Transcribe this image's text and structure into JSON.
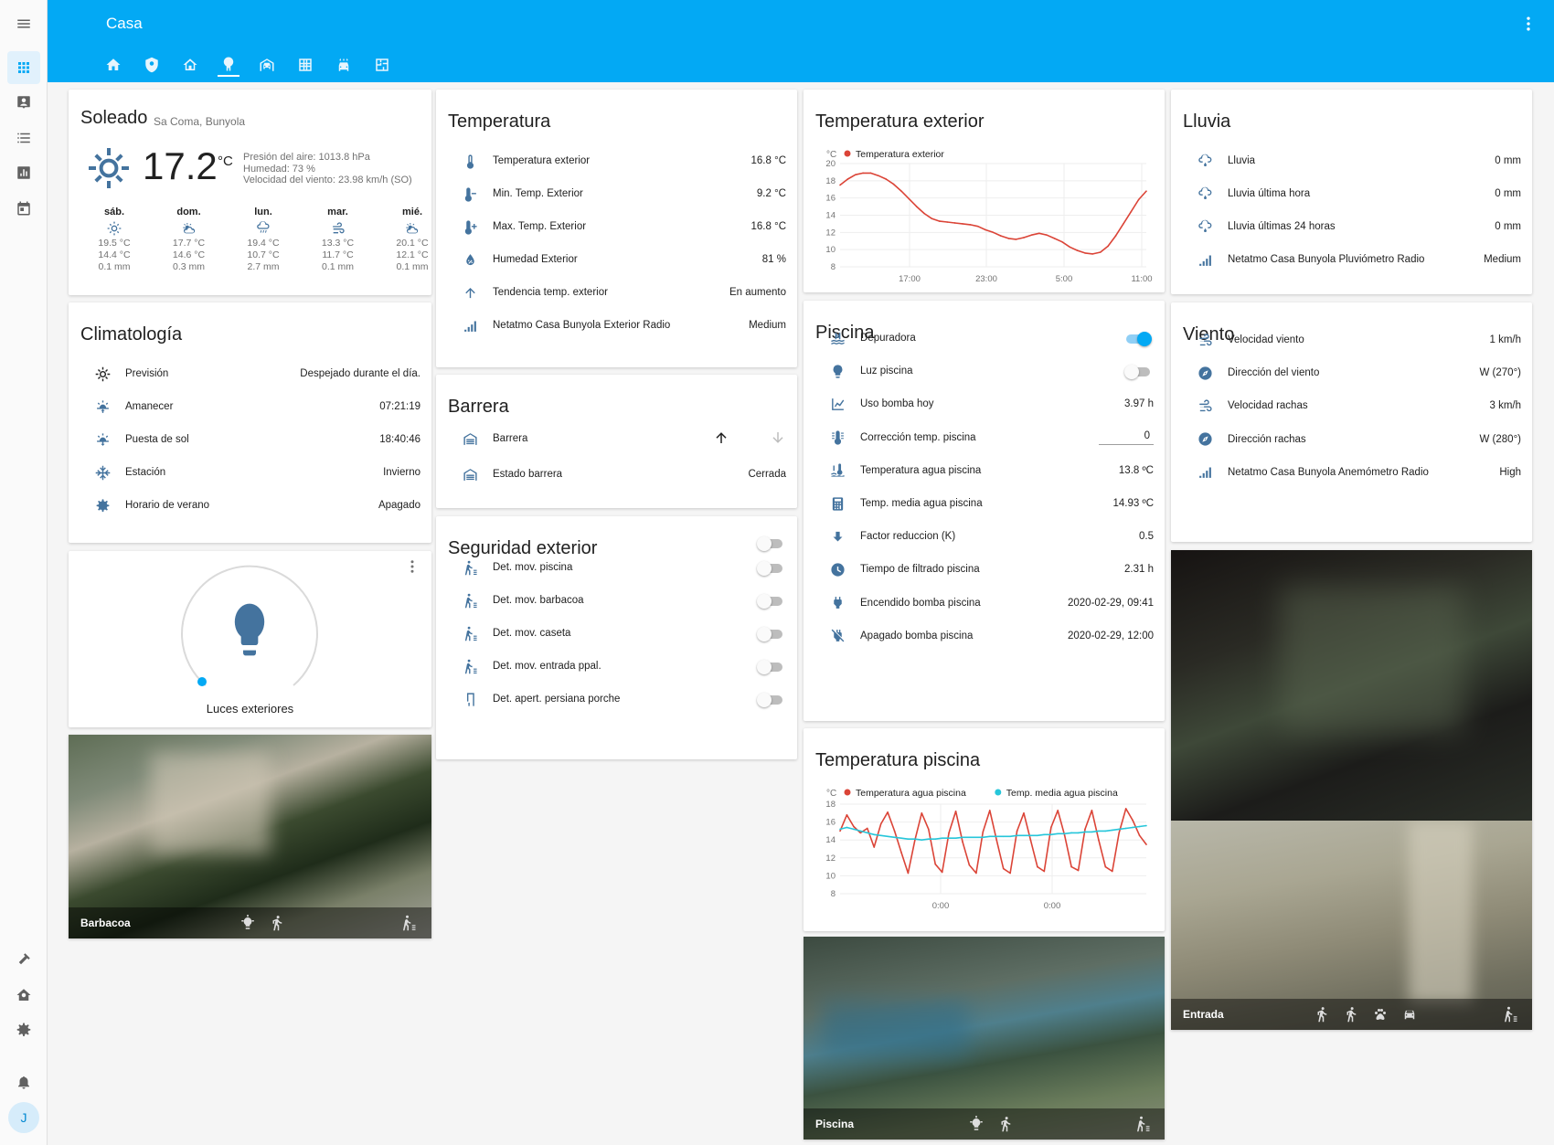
{
  "app": {
    "title": "Casa",
    "avatar": "J"
  },
  "colors": {
    "primary": "#03a9f4",
    "icon": "#44739e",
    "red_series": "#db4437",
    "teal_series": "#26c6da"
  },
  "sidebar_icons": [
    "menu-icon",
    "overview-icon",
    "map-icon",
    "logbook-icon",
    "history-icon",
    "calendar-icon",
    "developer-tools-icon",
    "configuration-home-icon",
    "settings-icon",
    "notifications-icon"
  ],
  "tabs": [
    "home-icon",
    "shield-icon",
    "home-outline-icon",
    "tree-icon",
    "garage-icon",
    "grid-icon",
    "car-wash-icon",
    "floor-plan-icon"
  ],
  "weather": {
    "condition": "Soleado",
    "location": "Sa Coma, Bunyola",
    "temp": "17.2",
    "unit": "°C",
    "pressure": "Presión del aire: 1013.8 hPa",
    "humidity": "Humedad: 73 %",
    "wind": "Velocidad del viento: 23.98 km/h (SO)",
    "forecast": [
      {
        "day": "sáb.",
        "icon": "sunny-icon",
        "high": "19.5 °C",
        "low": "14.4 °C",
        "rain": "0.1 mm"
      },
      {
        "day": "dom.",
        "icon": "partly-cloudy-icon",
        "high": "17.7 °C",
        "low": "14.6 °C",
        "rain": "0.3 mm"
      },
      {
        "day": "lun.",
        "icon": "rainy-icon",
        "high": "19.4 °C",
        "low": "10.7 °C",
        "rain": "2.7 mm"
      },
      {
        "day": "mar.",
        "icon": "windy-icon",
        "high": "13.3 °C",
        "low": "11.7 °C",
        "rain": "0.1 mm"
      },
      {
        "day": "mié.",
        "icon": "partly-cloudy-icon",
        "high": "20.1 °C",
        "low": "12.1 °C",
        "rain": "0.1 mm"
      }
    ]
  },
  "climatologia": {
    "title": "Climatología",
    "rows": [
      {
        "icon": "sun-icon",
        "label": "Previsión",
        "value": "Despejado durante el día."
      },
      {
        "icon": "sunrise-icon",
        "label": "Amanecer",
        "value": "07:21:19"
      },
      {
        "icon": "sunset-icon",
        "label": "Puesta de sol",
        "value": "18:40:46"
      },
      {
        "icon": "snowflake-icon",
        "label": "Estación",
        "value": "Invierno"
      },
      {
        "icon": "gear-icon",
        "label": "Horario de verano",
        "value": "Apagado"
      }
    ]
  },
  "light": {
    "name": "Luces exteriores",
    "level": 0.0
  },
  "cameras": {
    "barbacoa": {
      "name": "Barbacoa"
    },
    "piscina": {
      "name": "Piscina"
    },
    "entrada": {
      "name": "Entrada"
    }
  },
  "temperatura": {
    "title": "Temperatura",
    "rows": [
      {
        "icon": "thermometer-icon",
        "label": "Temperatura exterior",
        "value": "16.8 °C"
      },
      {
        "icon": "thermometer-minus-icon",
        "label": "Min. Temp. Exterior",
        "value": "9.2 °C"
      },
      {
        "icon": "thermometer-plus-icon",
        "label": "Max. Temp. Exterior",
        "value": "16.8 °C"
      },
      {
        "icon": "water-percent-icon",
        "label": "Humedad Exterior",
        "value": "81 %"
      },
      {
        "icon": "arrow-up-icon",
        "label": "Tendencia temp. exterior",
        "value": "En aumento"
      },
      {
        "icon": "signal-icon",
        "label": "Netatmo Casa Bunyola Exterior Radio",
        "value": "Medium"
      }
    ]
  },
  "barrera": {
    "title": "Barrera",
    "rows": [
      {
        "icon": "garage-icon",
        "label": "Barrera"
      },
      {
        "icon": "garage-icon",
        "label": "Estado barrera",
        "value": "Cerrada"
      }
    ]
  },
  "seguridad": {
    "title": "Seguridad exterior",
    "rows": [
      {
        "icon": "motion-sensor-icon",
        "label": "Det. mov. piscina"
      },
      {
        "icon": "motion-sensor-icon",
        "label": "Det. mov. barbacoa"
      },
      {
        "icon": "motion-sensor-icon",
        "label": "Det. mov. caseta"
      },
      {
        "icon": "motion-sensor-icon",
        "label": "Det. mov. entrada ppal."
      },
      {
        "icon": "door-icon",
        "label": "Det. apert. persiana porche"
      }
    ]
  },
  "temp_ext_chart": {
    "title": "Temperatura exterior"
  },
  "piscina": {
    "title": "Piscina",
    "rows": [
      {
        "icon": "pool-icon",
        "label": "Depuradora",
        "toggle": true
      },
      {
        "icon": "lightbulb-icon",
        "label": "Luz piscina",
        "toggle": false
      },
      {
        "icon": "chart-line-icon",
        "label": "Uso bomba hoy",
        "value": "3.97 h"
      },
      {
        "icon": "thermometer-lines-icon",
        "label": "Corrección temp. piscina",
        "value": "0"
      },
      {
        "icon": "pool-thermometer-icon",
        "label": "Temperatura agua piscina",
        "value": "13.8 ºC"
      },
      {
        "icon": "calculator-icon",
        "label": "Temp. media agua piscina",
        "value": "14.93 ºC"
      },
      {
        "icon": "arrow-down-bold-icon",
        "label": "Factor reduccion (K)",
        "value": "0.5"
      },
      {
        "icon": "clock-icon",
        "label": "Tiempo de filtrado piscina",
        "value": "2.31 h"
      },
      {
        "icon": "power-plug-icon",
        "label": "Encendido bomba piscina",
        "value": "2020-02-29, 09:41"
      },
      {
        "icon": "power-plug-off-icon",
        "label": "Apagado bomba piscina",
        "value": "2020-02-29, 12:00"
      }
    ]
  },
  "temp_piscina_chart": {
    "title": "Temperatura piscina"
  },
  "lluvia": {
    "title": "Lluvia",
    "rows": [
      {
        "icon": "rain-icon",
        "label": "Lluvia",
        "value": "0 mm"
      },
      {
        "icon": "rain-icon",
        "label": "Lluvia última hora",
        "value": "0 mm"
      },
      {
        "icon": "rain-icon",
        "label": "Lluvia últimas 24 horas",
        "value": "0 mm"
      },
      {
        "icon": "signal-icon",
        "label": "Netatmo Casa Bunyola Pluviómetro Radio",
        "value": "Medium"
      }
    ]
  },
  "viento": {
    "title": "Viento",
    "rows": [
      {
        "icon": "weather-windy-icon",
        "label": "Velocidad viento",
        "value": "1 km/h"
      },
      {
        "icon": "compass-icon",
        "label": "Dirección del viento",
        "value": "W (270°)"
      },
      {
        "icon": "weather-windy-icon",
        "label": "Velocidad rachas",
        "value": "3 km/h"
      },
      {
        "icon": "compass-icon",
        "label": "Dirección rachas",
        "value": "W (280°)"
      },
      {
        "icon": "signal-icon",
        "label": "Netatmo Casa Bunyola Anemómetro Radio",
        "value": "High"
      }
    ]
  },
  "chart_data": [
    {
      "type": "line",
      "title": "Temperatura exterior",
      "ylabel": "°C",
      "ylim": [
        8,
        20
      ],
      "yticks": [
        "20",
        "18",
        "16",
        "14",
        "12",
        "10",
        "8"
      ],
      "xticks": [
        "17:00",
        "23:00",
        "5:00",
        "11:00"
      ],
      "series": [
        {
          "name": "Temperatura exterior",
          "color": "#db4437",
          "x": [
            0,
            1,
            2,
            3,
            4,
            5,
            6,
            7,
            8,
            9,
            10,
            11,
            12,
            13,
            14,
            15,
            16,
            17,
            18,
            19,
            20,
            21,
            22,
            23,
            24,
            25,
            26,
            27,
            28,
            29,
            30,
            31,
            32,
            33,
            34,
            35,
            36,
            37,
            38,
            39,
            40
          ],
          "values": [
            17.5,
            18.2,
            18.7,
            18.9,
            18.9,
            18.6,
            18.2,
            17.6,
            16.8,
            15.9,
            15.0,
            14.2,
            13.6,
            13.3,
            13.2,
            13.1,
            13.0,
            12.9,
            12.7,
            12.3,
            12.0,
            11.6,
            11.3,
            11.2,
            11.4,
            11.7,
            11.9,
            11.7,
            11.3,
            10.9,
            10.3,
            9.9,
            9.6,
            9.5,
            9.7,
            10.4,
            11.6,
            13.0,
            14.4,
            15.8,
            16.8
          ]
        }
      ]
    },
    {
      "type": "line",
      "title": "Temperatura piscina",
      "ylabel": "°C",
      "ylim": [
        8,
        18
      ],
      "yticks": [
        "18",
        "16",
        "14",
        "12",
        "10",
        "8"
      ],
      "xticks": [
        "0:00",
        "0:00"
      ],
      "series": [
        {
          "name": "Temperatura agua piscina",
          "color": "#db4437",
          "values": [
            15.0,
            16.8,
            15.5,
            14.8,
            15.3,
            13.2,
            15.8,
            17.1,
            15.0,
            12.6,
            10.3,
            14.0,
            17.0,
            15.2,
            11.3,
            10.4,
            14.8,
            17.2,
            13.8,
            11.2,
            10.3,
            14.9,
            17.3,
            14.0,
            10.8,
            10.3,
            15.0,
            17.0,
            14.0,
            11.0,
            10.5,
            15.4,
            17.3,
            14.5,
            11.0,
            10.6,
            15.2,
            17.3,
            14.0,
            11.0,
            10.5,
            14.8,
            17.5,
            16.2,
            14.5,
            13.5
          ]
        },
        {
          "name": "Temp. media agua piscina",
          "color": "#26c6da",
          "values": [
            15.2,
            15.4,
            15.2,
            15.0,
            14.8,
            14.6,
            14.5,
            14.4,
            14.3,
            14.2,
            14.1,
            14.1,
            14.0,
            14.1,
            14.1,
            14.2,
            14.2,
            14.2,
            14.3,
            14.3,
            14.3,
            14.3,
            14.4,
            14.4,
            14.4,
            14.4,
            14.5,
            14.5,
            14.5,
            14.5,
            14.6,
            14.6,
            14.7,
            14.7,
            14.8,
            14.8,
            14.9,
            14.9,
            15.0,
            15.0,
            15.1,
            15.2,
            15.3,
            15.4,
            15.5,
            15.6
          ]
        }
      ]
    }
  ]
}
